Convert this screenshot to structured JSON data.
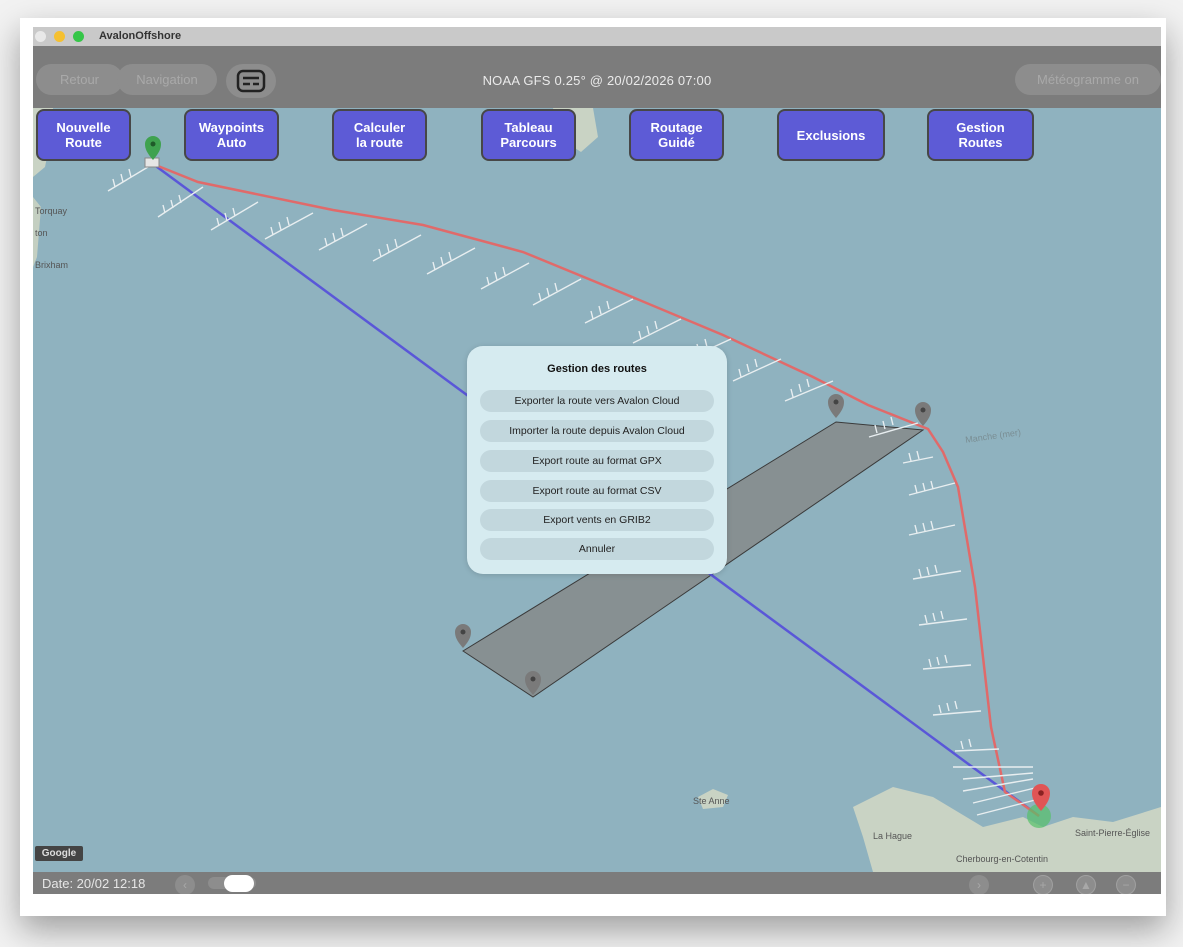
{
  "window": {
    "title": "AvalonOffshore"
  },
  "topbar": {
    "back_label": "Retour",
    "navigation_label": "Navigation",
    "grib_source": "NOAA GFS 0.25° @ 20/02/2026 07:00",
    "meteogram_label": "Météogramme on"
  },
  "actions": [
    {
      "label": "Nouvelle\nRoute"
    },
    {
      "label": "Waypoints\nAuto"
    },
    {
      "label": "Calculer\nla route"
    },
    {
      "label": "Tableau\nParcours"
    },
    {
      "label": "Routage\nGuidé"
    },
    {
      "label": "Exclusions"
    },
    {
      "label": "Gestion\nRoutes"
    }
  ],
  "colors": {
    "action_button": "#5d5bd6",
    "routed_line": "#e06a6a",
    "direct_line": "#5555dd",
    "sea": "#8fb2bf",
    "exclusion_zone": "#878a8a"
  },
  "map_labels": {
    "torquay": "Torquay",
    "ton": "ton",
    "brixham": "Brixham",
    "manche": "Manche (mer)",
    "ste_anne": "Ste Anne",
    "la_hague": "La Hague",
    "saint_pierre": "Saint-Pierre-Église",
    "cherbourg": "Cherbourg-en-Cotentin",
    "google": "Google"
  },
  "dialog": {
    "title": "Gestion des routes",
    "options": [
      "Exporter la route vers Avalon Cloud",
      "Importer la route depuis Avalon Cloud",
      "Export route au format GPX",
      "Export route au format CSV",
      "Export vents en GRIB2",
      "Annuler"
    ]
  },
  "bottombar": {
    "date_label": "Date: 20/02 12:18"
  },
  "icons": [
    "card-icon",
    "chevron-left-icon",
    "chevron-right-icon",
    "zoom-in-icon",
    "sailboat-icon",
    "zoom-out-icon",
    "map-pin-icon"
  ]
}
